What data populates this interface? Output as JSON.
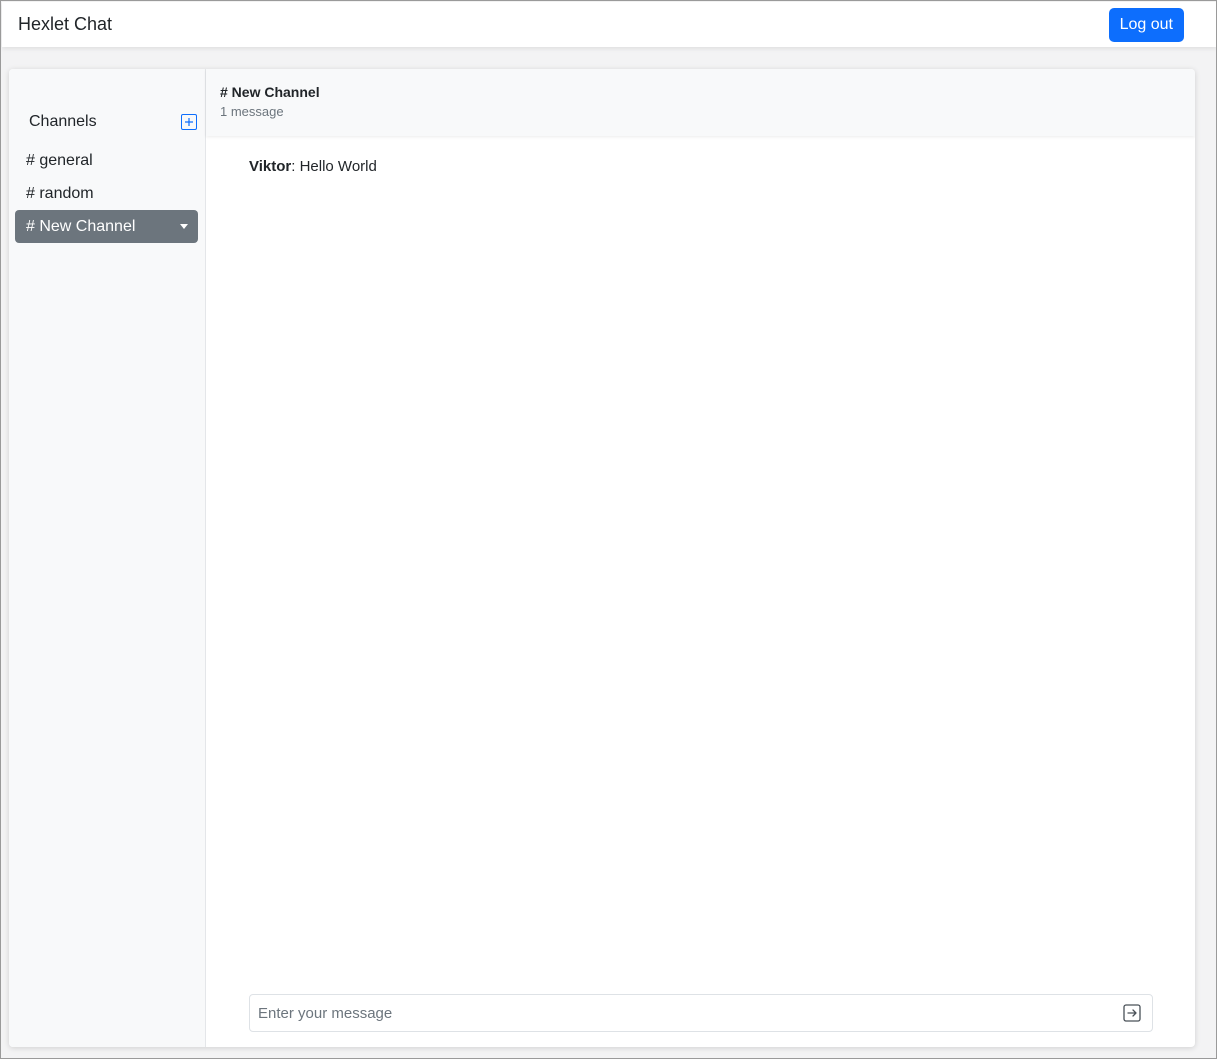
{
  "app": {
    "brand": "Hexlet Chat",
    "logout_label": "Log out"
  },
  "sidebar": {
    "title": "Channels",
    "channels": [
      {
        "label": "# general",
        "active": false
      },
      {
        "label": "# random",
        "active": false
      },
      {
        "label": "# New Channel",
        "active": true
      }
    ]
  },
  "chat": {
    "title": "# New Channel",
    "count": "1 message",
    "messages": [
      {
        "author": "Viktor",
        "text": ": Hello World"
      }
    ]
  },
  "composer": {
    "placeholder": "Enter your message"
  },
  "colors": {
    "accent": "#0d6efd",
    "active_channel": "#6c757d"
  },
  "icons": {
    "add": "plus-square-icon",
    "send": "arrow-right-square-icon",
    "menu": "caret-down-icon"
  }
}
